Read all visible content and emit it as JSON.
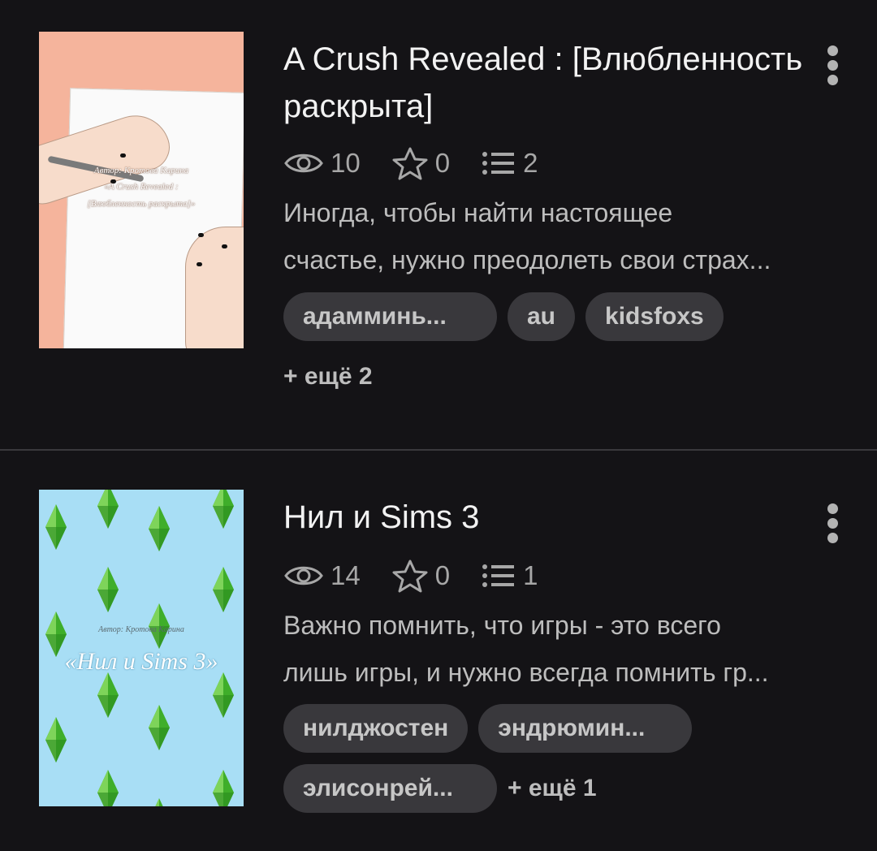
{
  "stories": [
    {
      "cover": {
        "author_text": "Автор: Кротова Карина",
        "title_text": "«A Crush Revealed :",
        "subtitle_text": "[Влюбленность раскрыта]»"
      },
      "title": "A Crush Revealed : [Влюбленность раскрыта]",
      "stats": {
        "views": "10",
        "stars": "0",
        "chapters": "2"
      },
      "description_line1": "Иногда, чтобы найти настоящее",
      "description_line2": "счастье, нужно преодолеть свои страх...",
      "tags": [
        "адамминь...",
        "au",
        "kidsfoxs"
      ],
      "more_tags": "+ ещё 2"
    },
    {
      "cover": {
        "author_text": "Автор: Кротова Карина",
        "title_text": "«Нил и Sims 3»"
      },
      "title": "Нил и Sims 3",
      "stats": {
        "views": "14",
        "stars": "0",
        "chapters": "1"
      },
      "description_line1": "Важно помнить, что игры - это всего",
      "description_line2": "лишь игры, и нужно всегда помнить гр...",
      "tags": [
        "нилджостен",
        "эндрюмин...",
        "элисонрей..."
      ],
      "more_tags": "+ ещё 1"
    }
  ],
  "colors": {
    "background": "#141316",
    "tag_background": "#39383c",
    "cover1_background": "#f5b49c",
    "cover2_background": "#a8def5",
    "plumbob_green": "#3fae2a"
  },
  "icons": {
    "views": "eye-icon",
    "stars": "star-icon",
    "chapters": "list-icon",
    "menu": "more-vertical-icon"
  }
}
